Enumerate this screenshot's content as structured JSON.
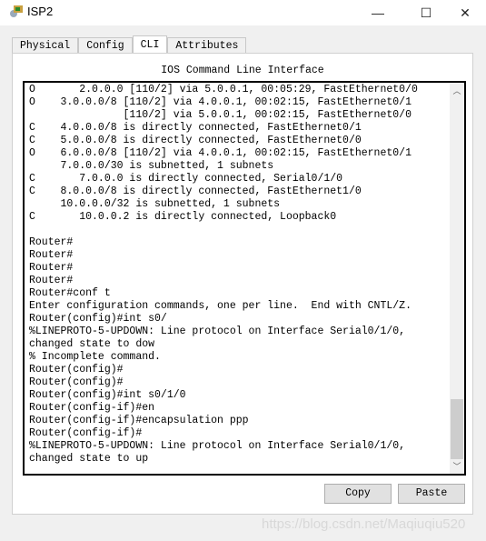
{
  "window": {
    "title": "ISP2",
    "icon": "router-app-icon"
  },
  "tabs": [
    {
      "label": "Physical"
    },
    {
      "label": "Config"
    },
    {
      "label": "CLI",
      "active": true
    },
    {
      "label": "Attributes"
    }
  ],
  "cli": {
    "heading": "IOS Command Line Interface",
    "lines": [
      "O       2.0.0.0 [110/2] via 5.0.0.1, 00:05:29, FastEthernet0/0",
      "O    3.0.0.0/8 [110/2] via 4.0.0.1, 00:02:15, FastEthernet0/1",
      "               [110/2] via 5.0.0.1, 00:02:15, FastEthernet0/0",
      "C    4.0.0.0/8 is directly connected, FastEthernet0/1",
      "C    5.0.0.0/8 is directly connected, FastEthernet0/0",
      "O    6.0.0.0/8 [110/2] via 4.0.0.1, 00:02:15, FastEthernet0/1",
      "     7.0.0.0/30 is subnetted, 1 subnets",
      "C       7.0.0.0 is directly connected, Serial0/1/0",
      "C    8.0.0.0/8 is directly connected, FastEthernet1/0",
      "     10.0.0.0/32 is subnetted, 1 subnets",
      "C       10.0.0.2 is directly connected, Loopback0",
      "",
      "Router#",
      "Router#",
      "Router#",
      "Router#",
      "Router#conf t",
      "Enter configuration commands, one per line.  End with CNTL/Z.",
      "Router(config)#int s0/",
      "%LINEPROTO-5-UPDOWN: Line protocol on Interface Serial0/1/0,",
      "changed state to dow",
      "% Incomplete command.",
      "Router(config)#",
      "Router(config)#",
      "Router(config)#int s0/1/0",
      "Router(config-if)#en",
      "Router(config-if)#encapsulation ppp",
      "Router(config-if)#",
      "%LINEPROTO-5-UPDOWN: Line protocol on Interface Serial0/1/0,",
      "changed state to up"
    ],
    "scroll_position_percent": 90
  },
  "buttons": {
    "copy": "Copy",
    "paste": "Paste"
  },
  "watermark": "https://blog.csdn.net/Maqiuqiu520"
}
